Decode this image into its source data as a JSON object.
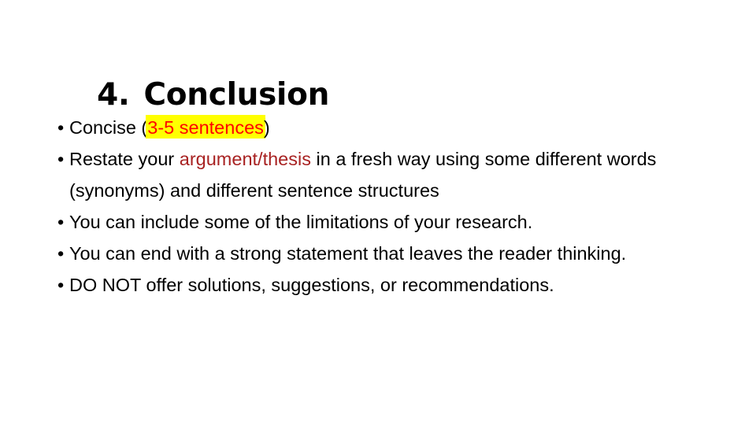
{
  "slide": {
    "background_color": "#ffffff",
    "title": {
      "number": "4.",
      "text": "Conclusion",
      "color": "#000000"
    },
    "bullets": [
      {
        "marker": "•",
        "runs": [
          {
            "text": "Concise (",
            "style": "plain"
          },
          {
            "text": "3-5 sentences",
            "style": "highlight-red-on-yellow"
          },
          {
            "text": ")",
            "style": "plain"
          }
        ]
      },
      {
        "marker": "•",
        "runs": [
          {
            "text": "Restate your ",
            "style": "plain"
          },
          {
            "text": "argument/thesis",
            "style": "red"
          },
          {
            "text": " in a fresh way using some different words (synonyms) and different sentence structures",
            "style": "plain"
          }
        ]
      },
      {
        "marker": "•",
        "runs": [
          {
            "text": "You can include some of the limitations of your research.",
            "style": "plain"
          }
        ]
      },
      {
        "marker": "•",
        "runs": [
          {
            "text": "You can end with a strong statement that leaves the reader thinking.",
            "style": "plain"
          }
        ]
      },
      {
        "marker": "•",
        "runs": [
          {
            "text": "DO NOT offer solutions, suggestions, or recommendations.",
            "style": "plain"
          }
        ]
      }
    ],
    "colors": {
      "text": "#000000",
      "highlight_background": "#ffff00",
      "highlight_text": "#ff0000",
      "emphasis_red": "#a82222",
      "background": "#ffffff"
    }
  }
}
